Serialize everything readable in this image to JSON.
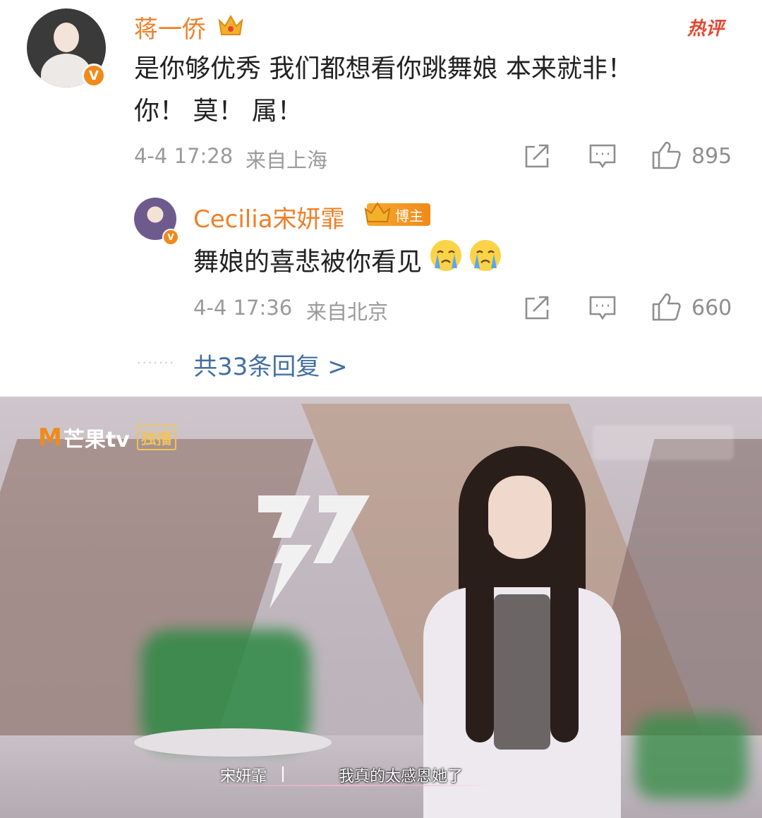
{
  "comment": {
    "user_name": "蒋一侨",
    "hot_label": "热评",
    "text_line1": "是你够优秀 我们都想看你跳舞娘 本来就非！",
    "text_line2": "你！ 莫！ 属！",
    "timestamp": "4-4 17:28",
    "location": "来自上海",
    "likes": "895"
  },
  "reply": {
    "user_name": "Cecilia宋妍霏",
    "badge_label": "博主",
    "text": "舞娘的喜悲被你看见",
    "emoji": [
      "crying-face",
      "crying-face"
    ],
    "timestamp": "4-4 17:36",
    "location": "来自北京",
    "likes": "660"
  },
  "more_replies": "共33条回复 >",
  "video": {
    "brand": "芒果tv",
    "brand_mark": "M",
    "exclusive": "独播",
    "subtitle_name": "宋妍霏",
    "subtitle_text": "我真的太感恩她了"
  },
  "colors": {
    "name_orange": "#f07f26",
    "hot_red": "#e5462f",
    "link_blue": "#436fa1",
    "meta_gray": "#9a9a9a"
  }
}
